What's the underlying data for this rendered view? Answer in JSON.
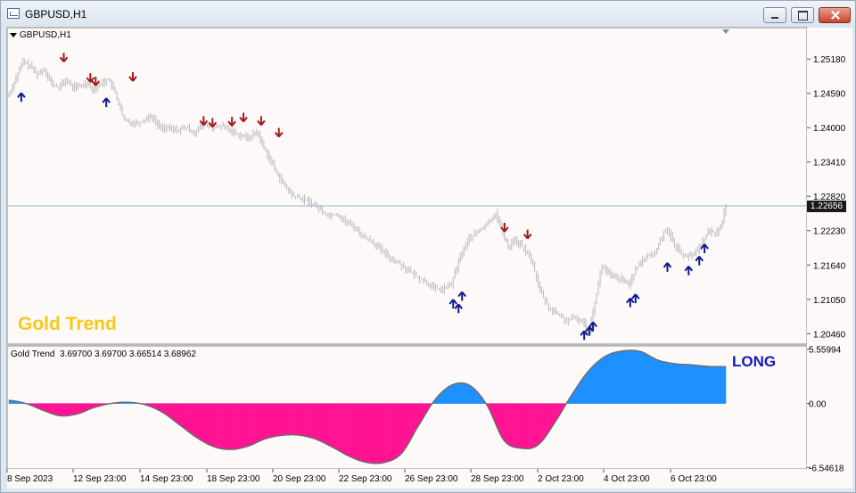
{
  "window": {
    "title": "GBPUSD,H1",
    "buttons": [
      "minimize",
      "maximize",
      "close"
    ]
  },
  "chart_header": {
    "symbol_label": "GBPUSD,H1",
    "overlay_label": "Gold Trend",
    "indicator_label": "Gold Trend  3.69700 3.69700 3.66514 3.68962",
    "signal_label": "LONG"
  },
  "colors": {
    "price": "#bdbdbd",
    "buy_arrow": "#0d1b8c",
    "sell_arrow": "#a31a1a",
    "positive_fill": "#1e90ff",
    "negative_fill": "#ff1493",
    "current_price_line": "#9eb2c6",
    "overlay_text": "#f7c81e",
    "signal_text": "#1417c4"
  },
  "chart_data": [
    {
      "type": "bar",
      "name": "price",
      "title": "GBPUSD,H1",
      "x_ticks": [
        "8 Sep 2023",
        "12 Sep 23:00",
        "14 Sep 23:00",
        "18 Sep 23:00",
        "20 Sep 23:00",
        "22 Sep 23:00",
        "26 Sep 23:00",
        "28 Sep 23:00",
        "2 Oct 23:00",
        "4 Oct 23:00",
        "6 Oct 23:00"
      ],
      "y_ticks": [
        1.2518,
        1.2459,
        1.24,
        1.2341,
        1.2282,
        1.2223,
        1.2164,
        1.2105,
        1.2046
      ],
      "y_tick_labels": [
        "1.25180",
        "1.24590",
        "1.24000",
        "1.23410",
        "1.22820",
        "1.22230",
        "1.21640",
        "1.21050",
        "1.20460"
      ],
      "ylim": [
        1.2028,
        1.2572
      ],
      "current_price": 1.22656,
      "current_price_label": "1.22656",
      "close_path": [
        [
          0,
          1.2457
        ],
        [
          8,
          1.2486
        ],
        [
          16,
          1.2514
        ],
        [
          24,
          1.2506
        ],
        [
          32,
          1.2492
        ],
        [
          40,
          1.2501
        ],
        [
          48,
          1.2475
        ],
        [
          56,
          1.2469
        ],
        [
          64,
          1.2482
        ],
        [
          72,
          1.247
        ],
        [
          80,
          1.2471
        ],
        [
          88,
          1.2477
        ],
        [
          96,
          1.2465
        ],
        [
          104,
          1.2476
        ],
        [
          112,
          1.2484
        ],
        [
          120,
          1.246
        ],
        [
          130,
          1.2413
        ],
        [
          140,
          1.2408
        ],
        [
          150,
          1.241
        ],
        [
          160,
          1.2421
        ],
        [
          170,
          1.2402
        ],
        [
          180,
          1.2399
        ],
        [
          190,
          1.2396
        ],
        [
          200,
          1.24
        ],
        [
          210,
          1.2392
        ],
        [
          220,
          1.2405
        ],
        [
          230,
          1.24
        ],
        [
          240,
          1.2403
        ],
        [
          250,
          1.2396
        ],
        [
          260,
          1.2388
        ],
        [
          270,
          1.2382
        ],
        [
          280,
          1.2393
        ],
        [
          290,
          1.236
        ],
        [
          300,
          1.233
        ],
        [
          310,
          1.2303
        ],
        [
          320,
          1.2284
        ],
        [
          330,
          1.2278
        ],
        [
          340,
          1.2272
        ],
        [
          350,
          1.2262
        ],
        [
          360,
          1.2249
        ],
        [
          370,
          1.2252
        ],
        [
          380,
          1.2239
        ],
        [
          390,
          1.223
        ],
        [
          400,
          1.2213
        ],
        [
          410,
          1.2205
        ],
        [
          420,
          1.219
        ],
        [
          430,
          1.2177
        ],
        [
          440,
          1.2168
        ],
        [
          450,
          1.2156
        ],
        [
          460,
          1.2145
        ],
        [
          470,
          1.2136
        ],
        [
          480,
          1.2124
        ],
        [
          490,
          1.2122
        ],
        [
          500,
          1.2131
        ],
        [
          510,
          1.2179
        ],
        [
          520,
          1.221
        ],
        [
          530,
          1.2221
        ],
        [
          540,
          1.2234
        ],
        [
          550,
          1.2253
        ],
        [
          555,
          1.2232
        ],
        [
          560,
          1.221
        ],
        [
          565,
          1.2194
        ],
        [
          570,
          1.2208
        ],
        [
          580,
          1.2196
        ],
        [
          590,
          1.2174
        ],
        [
          600,
          1.2121
        ],
        [
          610,
          1.209
        ],
        [
          620,
          1.208
        ],
        [
          630,
          1.2068
        ],
        [
          640,
          1.2073
        ],
        [
          650,
          1.2064
        ],
        [
          655,
          1.2049
        ],
        [
          660,
          1.2084
        ],
        [
          670,
          1.2163
        ],
        [
          680,
          1.2145
        ],
        [
          690,
          1.214
        ],
        [
          700,
          1.2131
        ],
        [
          710,
          1.216
        ],
        [
          720,
          1.2179
        ],
        [
          730,
          1.2184
        ],
        [
          740,
          1.2221
        ],
        [
          745,
          1.2226
        ],
        [
          750,
          1.2204
        ],
        [
          760,
          1.2183
        ],
        [
          770,
          1.2178
        ],
        [
          780,
          1.2194
        ],
        [
          790,
          1.2221
        ],
        [
          800,
          1.222
        ],
        [
          805,
          1.2233
        ],
        [
          810,
          1.2268
        ]
      ],
      "markers": {
        "sell": [
          [
            62,
            1.2521
          ],
          [
            92,
            1.2486
          ],
          [
            98,
            1.248
          ],
          [
            140,
            1.2488
          ],
          [
            220,
            1.2412
          ],
          [
            230,
            1.2409
          ],
          [
            252,
            1.2411
          ],
          [
            265,
            1.2418
          ],
          [
            285,
            1.2412
          ],
          [
            305,
            1.2392
          ],
          [
            560,
            1.2229
          ],
          [
            586,
            1.2217
          ]
        ],
        "buy": [
          [
            14,
            1.2452
          ],
          [
            110,
            1.2443
          ],
          [
            502,
            1.2097
          ],
          [
            508,
            1.2089
          ],
          [
            512,
            1.211
          ],
          [
            650,
            1.2043
          ],
          [
            656,
            1.205
          ],
          [
            660,
            1.2058
          ],
          [
            702,
            1.2099
          ],
          [
            708,
            1.2106
          ],
          [
            744,
            1.216
          ],
          [
            768,
            1.2154
          ],
          [
            780,
            1.2171
          ],
          [
            786,
            1.2192
          ]
        ]
      }
    },
    {
      "type": "area",
      "name": "Gold Trend",
      "y_ticks": [
        5.55994,
        0.0,
        -6.54618
      ],
      "y_tick_labels": [
        "5.55994",
        "0.00",
        "-6.54618"
      ],
      "ylim": [
        -6.7,
        5.9
      ],
      "values": [
        0.33,
        0.0,
        -0.7,
        -1.26,
        -1.07,
        -0.41,
        0.01,
        0.13,
        -0.14,
        -0.91,
        -2.19,
        -3.49,
        -4.42,
        -4.71,
        -4.38,
        -3.63,
        -3.26,
        -3.25,
        -3.67,
        -4.52,
        -5.46,
        -6.05,
        -6.04,
        -5.12,
        -2.26,
        0.47,
        1.93,
        1.85,
        -0.15,
        -3.77,
        -4.58,
        -4.25,
        -1.91,
        0.96,
        3.42,
        4.9,
        5.39,
        5.33,
        4.46,
        4.08,
        3.96,
        3.8,
        3.78
      ]
    }
  ]
}
